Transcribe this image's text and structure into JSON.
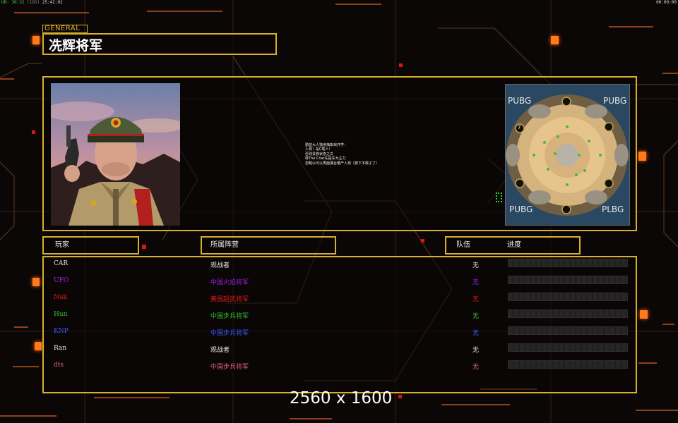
{
  "status_bar": {
    "left_parts": [
      "UR: 30:32",
      "(185)",
      "25:42:02"
    ],
    "right": "00:00:00"
  },
  "header": {
    "tag": "GENERAL",
    "title": "冼辉将军"
  },
  "briefing": {
    "lines": [
      "勤益大人独身抽象戏开学：",
      "人狗！是C载人！",
      "否则贵族状态之文",
      "转The Chat先提车为主力",
      "忽略以可以再面藻台量产人狗（旅下不敢子了）"
    ]
  },
  "minimap": {
    "corner_labels": [
      "PUBG",
      "PUBG",
      "PUBG",
      "PLBG"
    ],
    "start_label": "7"
  },
  "table": {
    "columns": {
      "player": "玩家",
      "faction": "所属阵营",
      "team": "队伍",
      "progress": "进度"
    },
    "rows": [
      {
        "player": "CAR",
        "faction": "观战者",
        "team": "无",
        "color": "#e6e6e6",
        "progress": 0
      },
      {
        "player": "UFO",
        "faction": "中国火焰将军",
        "team": "无",
        "color": "#9a1fe0",
        "progress": 0
      },
      {
        "player": "Nuk",
        "faction": "美国超武将军",
        "team": "无",
        "color": "#e01a1a",
        "progress": 0
      },
      {
        "player": "Hun",
        "faction": "中国步兵将军",
        "team": "无",
        "color": "#2ec42e",
        "progress": 0
      },
      {
        "player": "KNP",
        "faction": "中国步兵将军",
        "team": "无",
        "color": "#3d5cff",
        "progress": 0
      },
      {
        "player": "Ran",
        "faction": "观战者",
        "team": "无",
        "color": "#e6e6e6",
        "progress": 0
      },
      {
        "player": "dts",
        "faction": "中国步兵将军",
        "team": "无",
        "color": "#e0607a",
        "progress": 0
      }
    ]
  },
  "resolution": "2560 x 1600",
  "colors": {
    "frame": "#d6b02a",
    "accent_orange": "#ff7a1a",
    "accent_red": "#d81616"
  }
}
